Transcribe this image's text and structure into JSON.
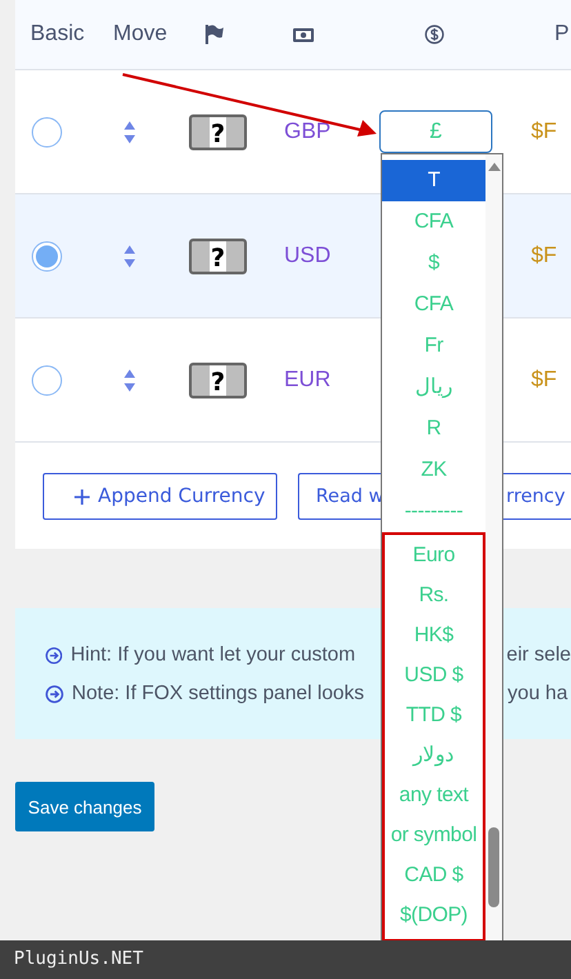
{
  "table": {
    "columns": [
      {
        "kind": "text",
        "label": "Basic"
      },
      {
        "kind": "text",
        "label": "Move"
      },
      {
        "kind": "flag"
      },
      {
        "kind": "money"
      },
      {
        "kind": "symbol"
      },
      {
        "kind": "text",
        "label": "P"
      }
    ],
    "rows": [
      {
        "selected": false,
        "highlighted": false,
        "flag_text": "?",
        "code": "GBP",
        "symbol": "£",
        "column_6": "$F"
      },
      {
        "selected": true,
        "highlighted": true,
        "flag_text": "?",
        "code": "USD",
        "column_6": "$F"
      },
      {
        "selected": false,
        "highlighted": false,
        "flag_text": "?",
        "code": "EUR",
        "column_6": "$F"
      }
    ]
  },
  "buttons": [
    {
      "kind": "add",
      "label": "Append Currency"
    },
    {
      "kind": "split",
      "parts": [
        "Read w",
        "rrency"
      ]
    }
  ],
  "notes": [
    {
      "parts": [
        "Hint: If you want let your custom",
        "eir sele"
      ]
    },
    {
      "parts": [
        "Note: If FOX settings panel looks",
        "you ha"
      ]
    }
  ],
  "save_button": "Save changes",
  "dropdown": {
    "options": [
      {
        "label": "T",
        "selected": true
      },
      {
        "label": "CFA",
        "selected": false
      },
      {
        "label": "$",
        "selected": false
      },
      {
        "label": "CFA",
        "selected": false
      },
      {
        "label": "Fr",
        "selected": false
      },
      {
        "label": "ريال",
        "selected": false
      },
      {
        "label": "R",
        "selected": false
      },
      {
        "label": "ZK",
        "selected": false
      },
      {
        "label": "---------",
        "selected": false
      },
      {
        "label": "Euro",
        "selected": false
      },
      {
        "label": "Rs.",
        "selected": false
      },
      {
        "label": "HK$",
        "selected": false
      },
      {
        "label": "USD $",
        "selected": false
      },
      {
        "label": "TTD $",
        "selected": false
      },
      {
        "label": "دولار",
        "selected": false
      },
      {
        "label": "any text",
        "selected": false
      },
      {
        "label": "or symbol",
        "selected": false
      },
      {
        "label": "CAD $",
        "selected": false
      },
      {
        "label": "$(DOP)",
        "selected": false
      }
    ]
  },
  "footer": "PluginUs.NET"
}
